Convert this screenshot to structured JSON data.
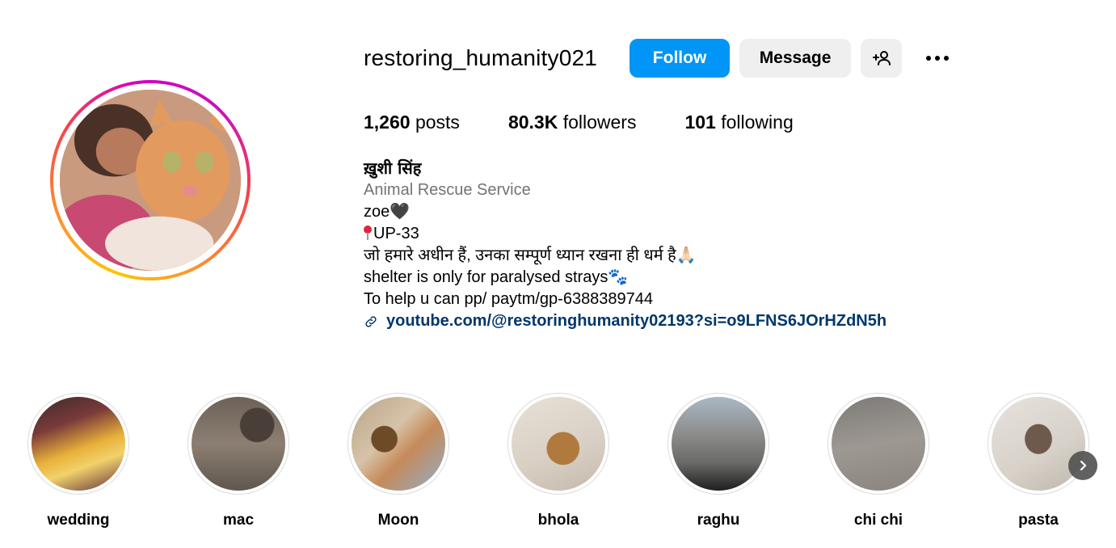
{
  "profile": {
    "username": "restoring_humanity021",
    "follow_label": "Follow",
    "message_label": "Message",
    "add_user_icon": "add-user-icon",
    "more_icon": "more-options-icon"
  },
  "stats": {
    "posts_count": "1,260",
    "posts_label": "posts",
    "followers_count": "80.3K",
    "followers_label": "followers",
    "following_count": "101",
    "following_label": "following"
  },
  "bio": {
    "name": "ख़ुशी सिंह",
    "category": "Animal Rescue Service",
    "line1": "zoe🖤",
    "line2": "UP-33",
    "line3": "जो हमारे अधीन हैं, उनका सम्पूर्ण ध्यान रखना ही धर्म है🙏🏻",
    "line4": "shelter is only for paralysed strays🐾",
    "line5": "To help u can pp/ paytm/gp-6388389744",
    "link": "youtube.com/@restoringhumanity02193?si=o9LFNS6JOrHZdN5h"
  },
  "highlights": [
    {
      "label": "wedding"
    },
    {
      "label": "mac"
    },
    {
      "label": "Moon"
    },
    {
      "label": "bhola"
    },
    {
      "label": "raghu"
    },
    {
      "label": "chi chi"
    },
    {
      "label": "pasta"
    }
  ],
  "colors": {
    "accent": "#0095f6",
    "button_secondary": "#efefef",
    "link": "#00376b",
    "muted": "#737373"
  }
}
